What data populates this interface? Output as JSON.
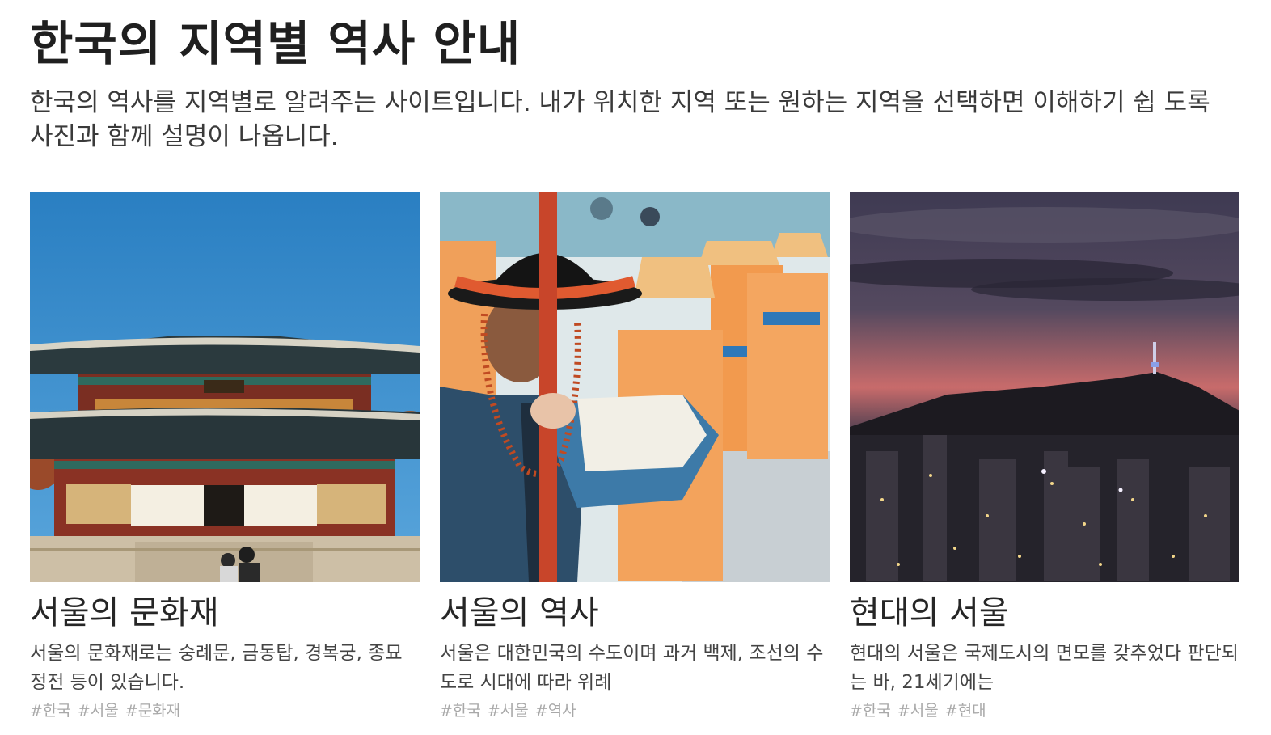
{
  "header": {
    "title": "한국의 지역별 역사 안내",
    "description": "한국의 역사를 지역별로 알려주는 사이트입니다. 내가 위치한 지역 또는 원하는 지역을 선택하면 이해하기 쉽 도록 사진과 함께 설명이 나옵니다."
  },
  "cards": [
    {
      "title": "서울의 문화재",
      "description": "서울의 문화재로는 숭례문, 금동탑, 경복궁, 종묘 정전 등이 있습니다.",
      "tags": [
        "#한국",
        "#서울",
        "#문화재"
      ],
      "image": "palace-photo"
    },
    {
      "title": "서울의 역사",
      "description": "서울은 대한민국의 수도이며 과거 백제, 조선의 수도로 시대에 따라 위례",
      "tags": [
        "#한국",
        "#서울",
        "#역사"
      ],
      "image": "royal-guard-photo"
    },
    {
      "title": "현대의 서울",
      "description": "현대의 서울은 국제도시의 면모를 갖추었다 판단되는 바, 21세기에는",
      "tags": [
        "#한국",
        "#서울",
        "#현대"
      ],
      "image": "night-city-photo"
    }
  ],
  "colors": {
    "sky_blue": "#2f86c8",
    "hanbok_orange": "#f2a35e",
    "dusk_pink": "#c86b6b"
  }
}
